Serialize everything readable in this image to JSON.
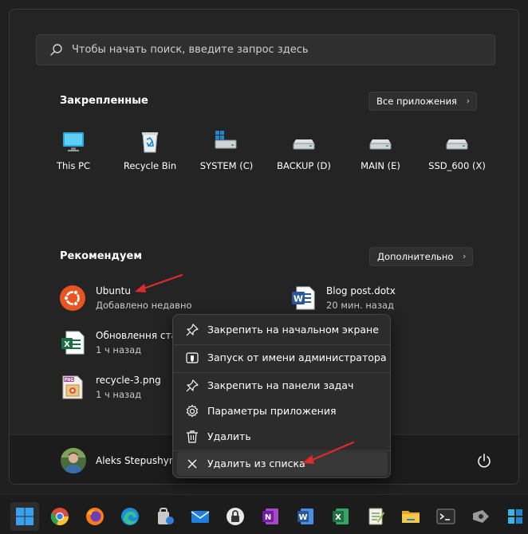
{
  "search": {
    "placeholder": "Чтобы начать поиск, введите запрос здесь"
  },
  "pinned": {
    "title": "Закрепленные",
    "all_apps_label": "Все приложения",
    "items": [
      {
        "label": "This PC",
        "icon": "monitor-icon"
      },
      {
        "label": "Recycle Bin",
        "icon": "recycle-bin-icon"
      },
      {
        "label": "SYSTEM (C)",
        "icon": "system-drive-icon"
      },
      {
        "label": "BACKUP (D)",
        "icon": "drive-icon"
      },
      {
        "label": "MAIN (E)",
        "icon": "drive-icon"
      },
      {
        "label": "SSD_600 (X)",
        "icon": "drive-icon"
      }
    ]
  },
  "recommended": {
    "title": "Рекомендуем",
    "more_label": "Дополнительно",
    "items": [
      {
        "name": "Ubuntu",
        "sub": "Добавлено недавно",
        "icon": "ubuntu-icon"
      },
      {
        "name": "Blog post.dotx",
        "sub": "20 мин. назад",
        "icon": "word-document-icon"
      },
      {
        "name": "Обновлення стат",
        "sub": "1 ч назад",
        "icon": "excel-document-icon"
      },
      {
        "name": "recycle-3.png",
        "sub": "1 ч назад",
        "icon": "png-file-icon"
      }
    ]
  },
  "user": {
    "name": "Aleks Stepushyn"
  },
  "context_menu": {
    "items": [
      {
        "label": "Закрепить на начальном экране",
        "icon": "pin-icon"
      },
      {
        "label": "Запуск от имени администратора",
        "icon": "shield-icon"
      },
      {
        "label": "Закрепить на панели задач",
        "icon": "pin-icon"
      },
      {
        "label": "Параметры приложения",
        "icon": "gear-icon"
      },
      {
        "label": "Удалить",
        "icon": "trash-icon"
      },
      {
        "label": "Удалить из списка",
        "icon": "close-icon"
      }
    ]
  },
  "taskbar": {
    "icons": [
      "windows-start-icon",
      "chrome-icon",
      "firefox-icon",
      "edge-icon",
      "security-app-icon",
      "mail-icon",
      "lock-app-icon",
      "onenote-icon",
      "word-icon",
      "excel-icon",
      "notepad-app-icon",
      "folder-icon",
      "terminal-icon",
      "video-app-icon",
      "azure-icon"
    ]
  },
  "colors": {
    "accent_red": "#e02b2b",
    "ubuntu_orange": "#e95420",
    "word_blue": "#2b579a",
    "excel_green": "#1d6f42"
  }
}
